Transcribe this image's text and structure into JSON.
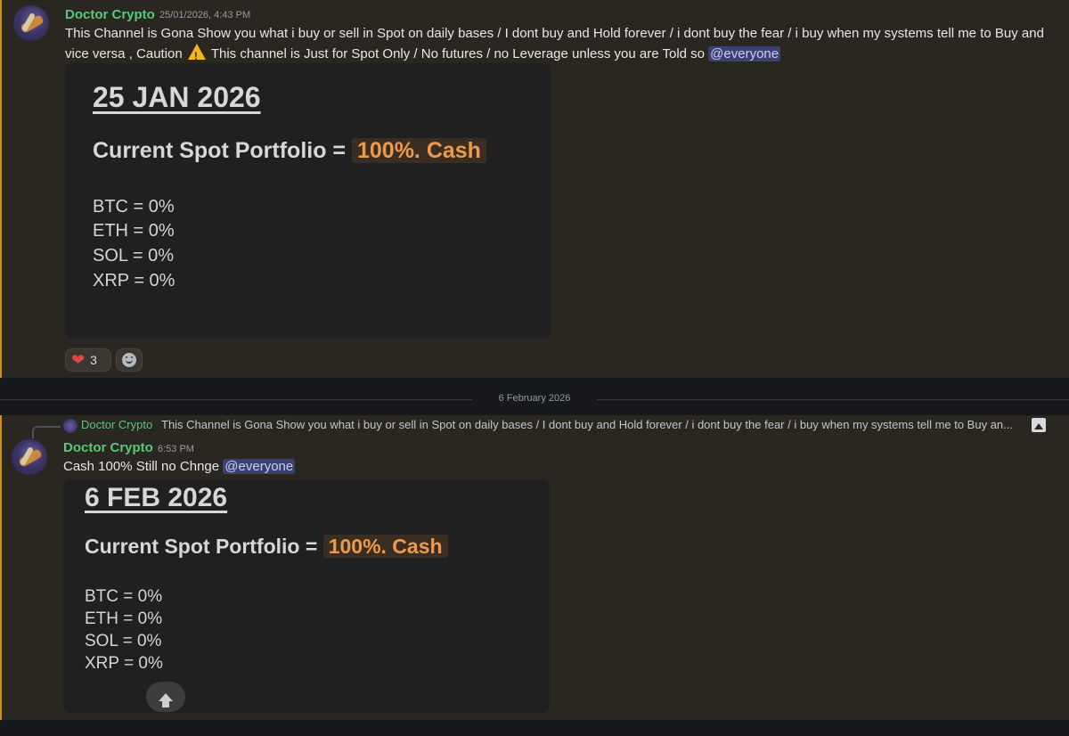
{
  "messages": [
    {
      "username": "Doctor Crypto",
      "timestamp": "25/01/2026, 4:43 PM",
      "text_before_warning": "This Channel is Gona Show you what i buy or sell in Spot on daily bases / I dont buy and Hold forever / i dont buy the fear / i buy when my systems tell me to Buy and vice versa , Caution",
      "text_after_warning": "This channel is Just for Spot Only / No futures / no Leverage unless you are Told so",
      "mention": "@everyone",
      "card": {
        "date": "25 JAN 2026",
        "heading": "Current Spot Portfolio =",
        "cash": "100%. Cash",
        "allocations": [
          "BTC = 0%",
          "ETH = 0%",
          "SOL = 0%",
          "XRP = 0%"
        ]
      },
      "reaction": {
        "emoji": "heart-icon",
        "count": "3"
      }
    },
    {
      "reply": {
        "username": "Doctor Crypto",
        "text": "This Channel is Gona Show you what i buy or sell in Spot on daily bases / I dont buy and Hold forever / i dont buy the fear / i buy when my systems tell me to Buy an..."
      },
      "username": "Doctor Crypto",
      "timestamp": "6:53 PM",
      "text": "Cash 100% Still no Chnge",
      "mention": "@everyone",
      "card": {
        "date": "6 FEB 2026",
        "heading": "Current Spot Portfolio =",
        "cash": "100%. Cash",
        "allocations": [
          "BTC = 0%",
          "ETH = 0%",
          "SOL = 0%",
          "XRP = 0%"
        ]
      }
    }
  ],
  "divider": {
    "label": "6 February 2026"
  },
  "colors": {
    "username": "#57c87c",
    "highlight_bar": "#c8901f",
    "cash_text": "#ee9a4a",
    "mention_bg": "#3c4270"
  }
}
